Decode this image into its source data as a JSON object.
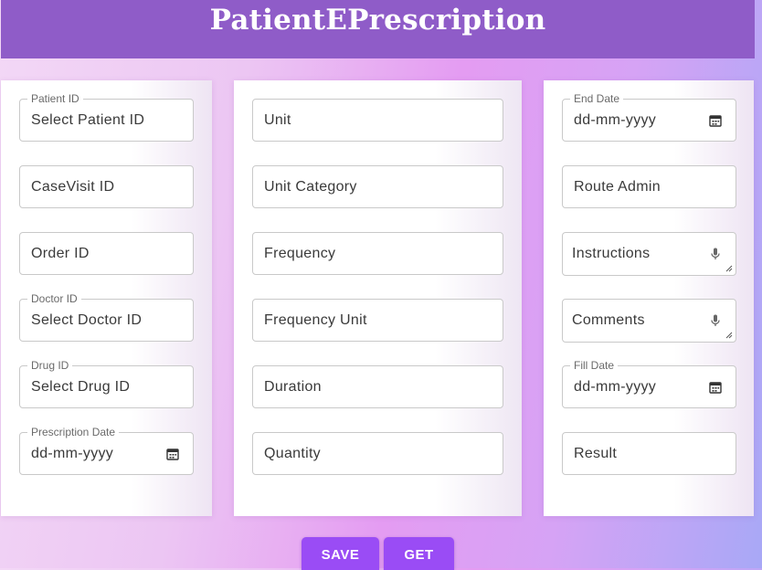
{
  "header": {
    "title": "PatientEPrescription"
  },
  "col1": {
    "patient_id": {
      "legend": "Patient ID",
      "value": "Select Patient ID"
    },
    "casevisit_id": {
      "placeholder": "CaseVisit ID"
    },
    "order_id": {
      "placeholder": "Order ID"
    },
    "doctor_id": {
      "legend": "Doctor ID",
      "value": "Select Doctor ID"
    },
    "drug_id": {
      "legend": "Drug ID",
      "value": "Select Drug ID"
    },
    "prescription_date": {
      "legend": "Prescription Date",
      "value": "dd-mm-yyyy"
    }
  },
  "col2": {
    "unit": {
      "placeholder": "Unit"
    },
    "unit_category": {
      "placeholder": "Unit Category"
    },
    "frequency": {
      "placeholder": "Frequency"
    },
    "frequency_unit": {
      "placeholder": "Frequency Unit"
    },
    "duration": {
      "placeholder": "Duration"
    },
    "quantity": {
      "placeholder": "Quantity"
    }
  },
  "col3": {
    "end_date": {
      "legend": "End Date",
      "value": "dd-mm-yyyy"
    },
    "route_admin": {
      "placeholder": "Route Admin"
    },
    "instructions": {
      "placeholder": "Instructions"
    },
    "comments": {
      "placeholder": "Comments"
    },
    "fill_date": {
      "legend": "Fill Date",
      "value": "dd-mm-yyyy"
    },
    "result": {
      "placeholder": "Result"
    }
  },
  "actions": {
    "save_label": "SAVE",
    "get_label": "GET"
  },
  "icons": {
    "calendar": "calendar-icon",
    "mic": "microphone-icon",
    "resize": "resize-grip-icon"
  },
  "colors": {
    "header_bg": "#8f5cc8",
    "button_bg": "#9a4cf5",
    "title_text": "#ffffff"
  }
}
